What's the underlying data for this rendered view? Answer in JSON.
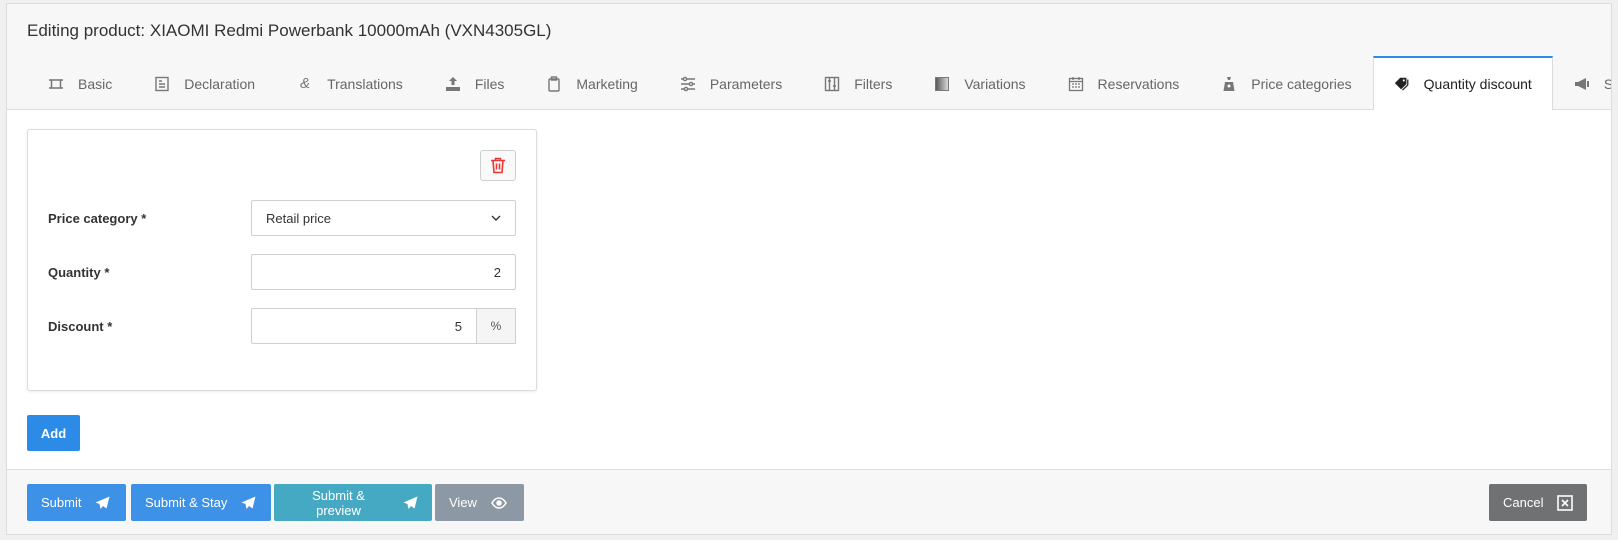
{
  "page": {
    "title": "Editing product: XIAOMI Redmi Powerbank 10000mAh (VXN4305GL)"
  },
  "tabs": [
    {
      "label": "Basic",
      "icon": "crop-icon"
    },
    {
      "label": "Declaration",
      "icon": "document-icon"
    },
    {
      "label": "Translations",
      "icon": "ampersand-icon"
    },
    {
      "label": "Files",
      "icon": "upload-icon"
    },
    {
      "label": "Marketing",
      "icon": "clipboard-icon"
    },
    {
      "label": "Parameters",
      "icon": "sliders-icon"
    },
    {
      "label": "Filters",
      "icon": "filter-icon"
    },
    {
      "label": "Variations",
      "icon": "gradient-icon"
    },
    {
      "label": "Reservations",
      "icon": "calendar-icon"
    },
    {
      "label": "Price categories",
      "icon": "money-bag-icon"
    },
    {
      "label": "Quantity discount",
      "icon": "tags-icon",
      "active": true
    },
    {
      "label": "SEO",
      "icon": "megaphone-icon"
    }
  ],
  "form": {
    "price_category": {
      "label": "Price category *",
      "value": "Retail price"
    },
    "quantity": {
      "label": "Quantity *",
      "value": "2"
    },
    "discount": {
      "label": "Discount *",
      "value": "5",
      "unit": "%"
    }
  },
  "buttons": {
    "add": "Add",
    "submit": "Submit",
    "submit_stay": "Submit & Stay",
    "submit_preview": "Submit & preview",
    "view": "View",
    "cancel": "Cancel"
  },
  "colors": {
    "primary": "#2c8be6",
    "info": "#46a9c4",
    "secondary": "#8c98a3",
    "dark": "#6f7173",
    "danger": "#e53935"
  }
}
